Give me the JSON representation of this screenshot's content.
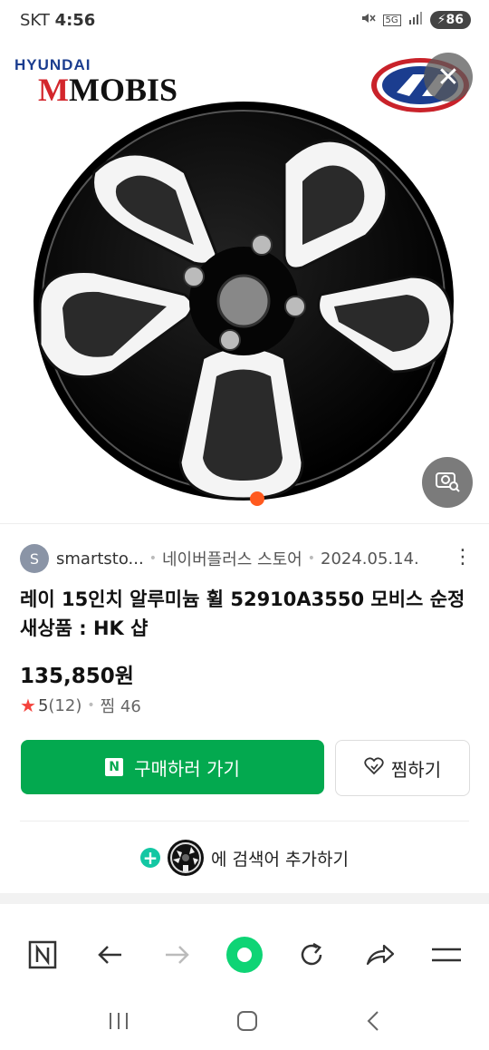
{
  "status_bar": {
    "carrier": "SKT",
    "time": "4:56",
    "network": "5G",
    "battery": "86"
  },
  "hero": {
    "brand_top": "HYUNDAI",
    "brand_bottom": "MOBIS"
  },
  "listing": {
    "avatar_letter": "S",
    "seller": "smartsto...",
    "store": "네이버플러스 스토어",
    "date": "2024.05.14.",
    "title": "레이 15인치 알루미늄 휠 52910A3550 모비스 순정 새상품 : HK 샵",
    "price": "135,850원",
    "rating": "5",
    "review_count": "(12)",
    "wish_count": "찜 46"
  },
  "actions": {
    "buy_badge": "N",
    "buy_label": "구매하러 가기",
    "wish_label": "찜하기",
    "add_keyword_label": "에 검색어 추가하기"
  },
  "colors": {
    "buy_green": "#03a94f",
    "star_red": "#f4433c",
    "plus_teal": "#13c7a3"
  }
}
